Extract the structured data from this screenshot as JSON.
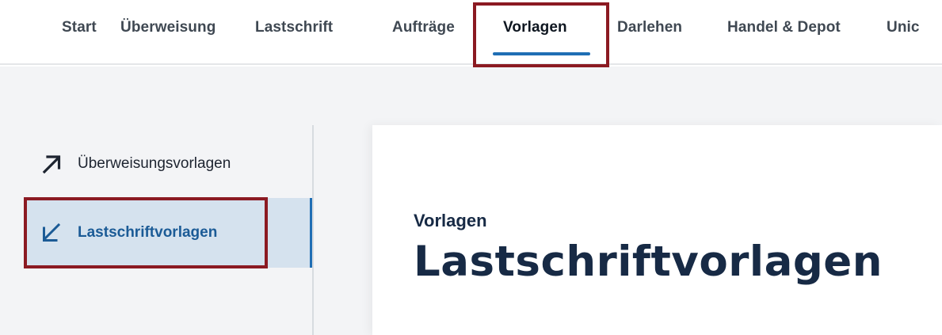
{
  "nav": {
    "items": [
      {
        "label": "Start"
      },
      {
        "label": "Überweisung"
      },
      {
        "label": "Lastschrift"
      },
      {
        "label": "Aufträge"
      },
      {
        "label": "Vorlagen",
        "active": true
      },
      {
        "label": "Darlehen"
      },
      {
        "label": "Handel & Depot"
      },
      {
        "label": "Unic"
      }
    ]
  },
  "sidebar": {
    "items": [
      {
        "label": "Überweisungsvorlagen",
        "icon": "arrow-up-right-icon"
      },
      {
        "label": "Lastschriftvorlagen",
        "icon": "arrow-down-left-icon",
        "active": true
      }
    ]
  },
  "main": {
    "eyebrow": "Vorlagen",
    "title": "Lastschriftvorlagen"
  },
  "colors": {
    "accent": "#1f6eb4",
    "highlight": "#8b1a22",
    "title": "#172a45",
    "active_bg": "#d5e2ee"
  }
}
